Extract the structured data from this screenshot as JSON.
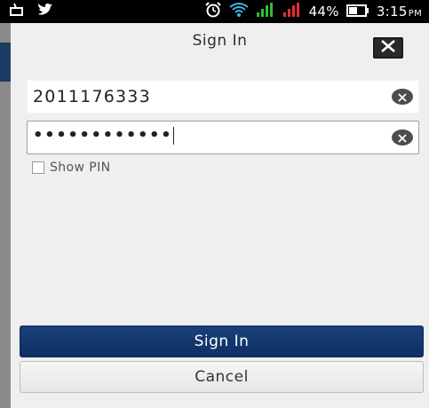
{
  "status_bar": {
    "battery_percent": "44%",
    "time": "3:15",
    "time_suffix": "PM",
    "colors": {
      "background": "#000000",
      "signal_green": "#2fbf2f",
      "signal_red": "#e03030",
      "wifi": "#3ab6e8"
    },
    "icons": [
      "notification-icon",
      "twitter-icon",
      "alarm-icon",
      "wifi-icon",
      "signal-icon",
      "signal-icon-2",
      "battery-icon"
    ]
  },
  "dialog": {
    "title": "Sign In",
    "close_icon": "close-icon",
    "user_field": {
      "value": "2011176333",
      "clear_icon": "clear-icon"
    },
    "pin_field": {
      "masked_value": "••••••••••••",
      "clear_icon": "clear-icon"
    },
    "show_pin": {
      "label": "Show PIN",
      "checked": false
    },
    "sign_in_button": "Sign In",
    "cancel_button": "Cancel",
    "colors": {
      "primary": "#123670",
      "background": "#efefef"
    }
  }
}
